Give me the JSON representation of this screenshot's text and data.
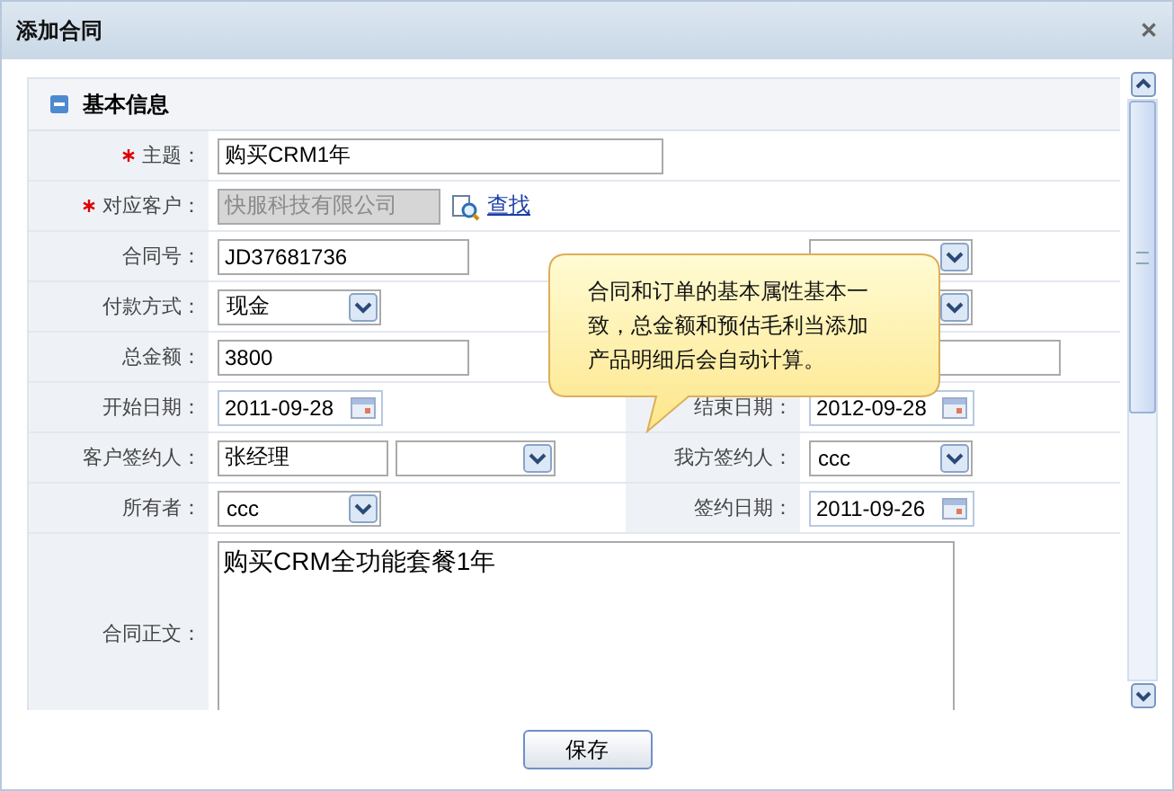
{
  "window": {
    "title": "添加合同",
    "close": "✕"
  },
  "section": {
    "title": "基本信息",
    "expanded": true
  },
  "rows": [
    {
      "label": "主题：",
      "required": true,
      "field": {
        "kind": "wide-text",
        "value": "购买CRM1年"
      }
    },
    {
      "label": "对应客户：",
      "required": true,
      "field": {
        "kind": "lookup",
        "value": "快服科技有限公司",
        "link": "查找"
      }
    },
    {
      "label": "合同号：",
      "required": false,
      "field": {
        "kind": "text",
        "value": "JD37681736"
      },
      "right": {
        "field": {
          "kind": "select"
        }
      }
    },
    {
      "label": "付款方式：",
      "required": false,
      "field": {
        "kind": "select",
        "value": "现金"
      },
      "right": {
        "field": {
          "kind": "select"
        }
      }
    },
    {
      "label": "总金额：",
      "required": false,
      "field": {
        "kind": "text",
        "value": "3800"
      },
      "right": {
        "field": {
          "kind": "text"
        }
      }
    },
    {
      "label": "开始日期：",
      "required": false,
      "field": {
        "kind": "date",
        "value": "2011-09-28"
      },
      "right": {
        "label": "结束日期：",
        "field": {
          "kind": "date",
          "value": "2012-09-28"
        }
      }
    },
    {
      "label": "客户签约人：",
      "required": false,
      "field": {
        "kind": "text-select",
        "value": "张经理"
      },
      "right": {
        "label": "我方签约人：",
        "field": {
          "kind": "select",
          "value": "ccc"
        }
      }
    },
    {
      "label": "所有者：",
      "required": false,
      "field": {
        "kind": "select",
        "value": "ccc"
      },
      "right": {
        "label": "签约日期：",
        "field": {
          "kind": "date",
          "value": "2011-09-26"
        }
      }
    },
    {
      "label": "合同正文：",
      "required": false,
      "field": {
        "kind": "textarea",
        "value": "购买CRM全功能套餐1年"
      }
    }
  ],
  "tooltip": "合同和订单的基本属性基本一致，总金额和预估毛利当添加产品明细后会自动计算。",
  "buttons": [
    {
      "label": "保存"
    }
  ]
}
